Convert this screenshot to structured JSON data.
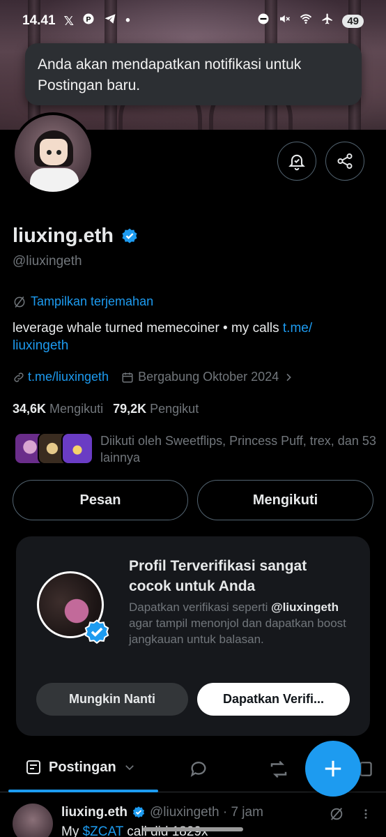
{
  "status_bar": {
    "time": "14.41",
    "dot": "•",
    "battery": "49",
    "left_icons": [
      "x-logo-icon",
      "pinterest-icon",
      "telegram-icon"
    ],
    "right_icons": [
      "dnd-icon",
      "mute-icon",
      "wifi-icon",
      "airplane-icon"
    ]
  },
  "toast": {
    "message": "Anda akan mendapatkan notifikasi untuk Postingan baru."
  },
  "profile": {
    "name": "liuxing.eth",
    "handle": "@liuxingeth",
    "translate_label": "Tampilkan terjemahan",
    "bio_text": "leverage whale turned memecoiner • my calls ",
    "bio_link": "t.me/\nliuxingeth",
    "link": "t.me/liuxingeth",
    "joined": "Bergabung Oktober 2024",
    "following_count": "34,6K",
    "following_label": "Mengikuti",
    "followers_count": "79,2K",
    "followers_label": "Pengikut",
    "followed_by": "Diikuti oleh Sweetflips, Princess Puff, trex, dan 53 lainnya"
  },
  "actions": {
    "message_button": "Pesan",
    "following_button": "Mengikuti"
  },
  "verify_card": {
    "title": "Profil Terverifikasi sangat cocok untuk Anda",
    "desc_before": "Dapatkan verifikasi seperti ",
    "desc_handle": "@liuxingeth",
    "desc_after": " agar tampil menonjol dan dapatkan boost jangkauan untuk balasan.",
    "later_button": "Mungkin Nanti",
    "get_button": "Dapatkan Verifi..."
  },
  "tabs": {
    "active_label": "Postingan"
  },
  "post": {
    "name": "liuxing.eth",
    "meta": "@liuxingeth · 7 jam",
    "text_before": "My ",
    "cashtag": "$ZCAT",
    "text_after": " call did 1829x"
  },
  "colors": {
    "accent": "#1d9bf0",
    "background": "#000000",
    "muted": "#71767b",
    "card": "#16181c"
  }
}
